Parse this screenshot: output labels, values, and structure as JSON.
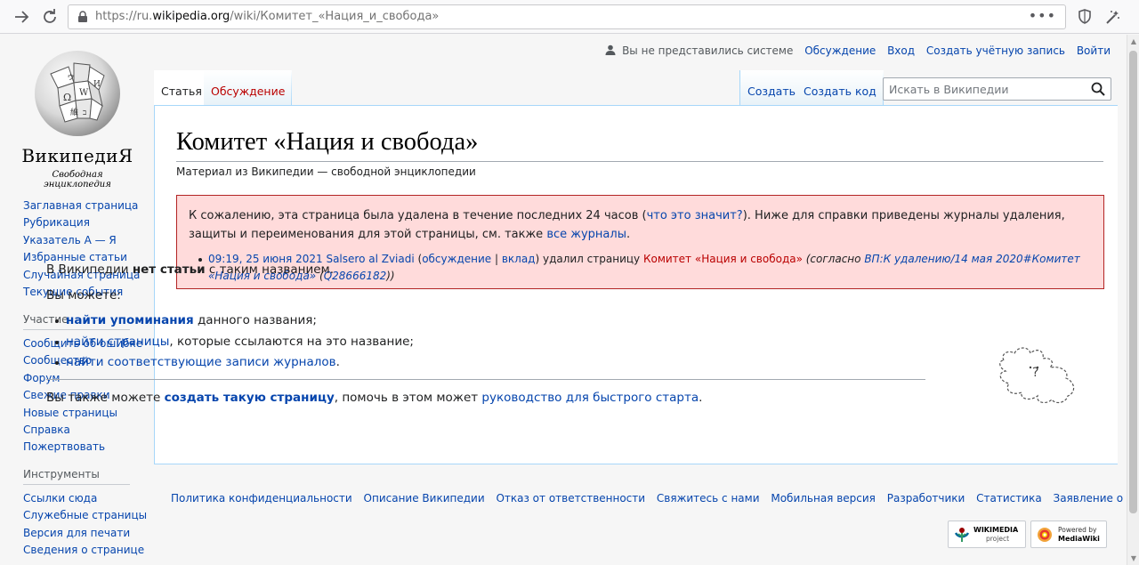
{
  "browser": {
    "url_prefix": "https://ru.",
    "url_domain": "wikipedia.org",
    "url_path": "/wiki/Комитет_«Нация_и_свобода»",
    "more_label": "•••"
  },
  "logo": {
    "wordmark": "ВикипедиЯ",
    "tagline": "Свободная энциклопедия"
  },
  "sidebar": {
    "navigation": [
      "Заглавная страница",
      "Рубрикация",
      "Указатель А — Я",
      "Избранные статьи",
      "Случайная страница",
      "Текущие события"
    ],
    "participation_heading": "Участие",
    "participation": [
      "Сообщить об ошибке",
      "Сообщество",
      "Форум",
      "Свежие правки",
      "Новые страницы",
      "Справка",
      "Пожертвовать"
    ],
    "tools_heading": "Инструменты",
    "tools": [
      "Ссылки сюда",
      "Служебные страницы",
      "Версия для печати",
      "Сведения о странице"
    ]
  },
  "personal": {
    "anon": "Вы не представились системе",
    "talk": "Обсуждение",
    "login": "Вход",
    "create_account": "Создать учётную запись",
    "logout": "Войти"
  },
  "tabs": {
    "article": "Статья",
    "talk": "Обсуждение",
    "create": "Создать",
    "create_code": "Создать код"
  },
  "search": {
    "placeholder": "Искать в Википедии"
  },
  "content": {
    "title": "Комитет «Нация и свобода»",
    "site_sub": "Материал из Википедии — свободной энциклопедии",
    "deletion": {
      "text_1": "К сожалению, эта страница была удалена в течение последних 24 часов (",
      "what_link": "что это значит?",
      "text_2": "). Ниже для справки приведены журналы удаления, защиты и переименования для этой страницы, см. также ",
      "all_logs": "все журналы",
      "text_3": ".",
      "log": {
        "datetime": "09:19, 25 июня 2021",
        "user": "Salsero al Zviadi",
        "paren_open": " (",
        "discussion": "обсуждение",
        "separator": " | ",
        "contrib": "вклад",
        "action": ") удалил страницу ",
        "page": "Комитет «Нация и свобода»",
        "reason_open": " (согласно ",
        "reason_link": "ВП:К удалению/14 мая 2020#Комитет «Нация и свобода»",
        "reason_mid": " (",
        "wikidata": "Q28666182",
        "reason_close": "))"
      }
    },
    "noarticle": {
      "line_prefix": "В Википедии ",
      "line_bold": "нет статьи",
      "line_suffix": " с таким названием.",
      "you_can": "Вы можете:",
      "options": [
        {
          "link": "найти упоминания",
          "rest": " данного названия;",
          "bold": true
        },
        {
          "link": "найти страницы",
          "rest": ", которые ссылаются на это название;",
          "bold": false
        },
        {
          "link": "найти соответствующие записи журналов",
          "rest": ".",
          "bold": false
        }
      ],
      "also_prefix": "Вы также можете ",
      "also_link": "создать такую страницу",
      "also_mid": ", помочь в этом может ",
      "also_link2": "руководство для быстрого старта",
      "also_suffix": "."
    }
  },
  "footer": {
    "links": [
      "Политика конфиденциальности",
      "Описание Википедии",
      "Отказ от ответственности",
      "Свяжитесь с нами",
      "Мобильная версия",
      "Разработчики",
      "Статистика",
      "Заявление о куки"
    ],
    "wikimedia_line1": "WIKIMEDIA",
    "wikimedia_line2": "project",
    "mediawiki_line1": "Powered by",
    "mediawiki_line2": "MediaWiki"
  },
  "colors": {
    "link": "#0645ad",
    "redlink": "#ba0000",
    "warning_bg": "#ffdbdb",
    "warning_border": "#b32424"
  }
}
